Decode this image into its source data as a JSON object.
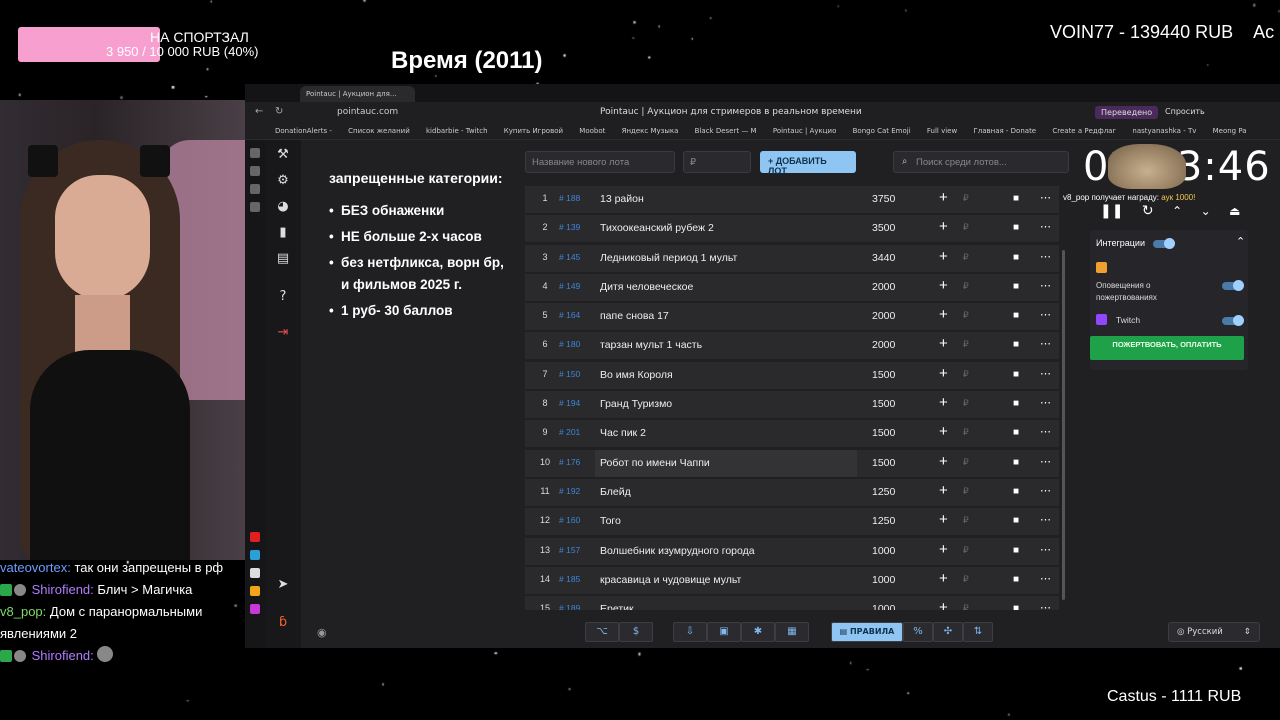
{
  "overlay": {
    "goal_title": "НА СПОРТЗАЛ",
    "goal_amount": "3 950 / 10 000 RUB (40%)",
    "goal_progress": 0.395,
    "movie_title": "Время (2011)",
    "top_donor": "VOIN77 - 139440 RUB",
    "top_donor_extra": "Ac",
    "bottom_donor": "Castus - 1111 RUB"
  },
  "chat": [
    {
      "user": "vateovortex:",
      "text": "так они запрещены в рф"
    },
    {
      "user": "Shirofiend:",
      "text": "Блич > Магичка"
    },
    {
      "user": "v8_pop:",
      "text": "Дом с паранормальными"
    },
    {
      "user": "",
      "text": "явлениями 2"
    },
    {
      "user": "Shirofiend:",
      "text": ""
    }
  ],
  "browser": {
    "tab_title": "Pointauc | Аукцион для...",
    "url": "pointauc.com",
    "page_title": "Pointauc | Аукцион для стримеров в реальном времени",
    "translated": "Переведено",
    "ask": "Спросить",
    "bookmarks": [
      "DonationAlerts -",
      "Список желаний",
      "kidbarbie - Twitch",
      "Купить Игровой",
      "Moobot",
      "Яндекс Музыка",
      "Black Desert — М",
      "Pointauc | Аукцио",
      "Bongo Cat Emoji",
      "Full view",
      "Главная - Donate",
      "Create a Редфлаг",
      "nastyanashka - Tv",
      "Meong Pa"
    ]
  },
  "rules": {
    "title": "запрещенные категории:",
    "items": [
      "БЕЗ обнаженки",
      "НЕ больше 2-х часов",
      "без нетфликса, ворн бр, и фильмов 2025 г.",
      "1 руб- 30 баллов"
    ]
  },
  "toolbar": {
    "lot_placeholder": "Название нового лота",
    "amount_placeholder": "₽",
    "add_label": "+ ДОБАВИТЬ ЛОТ",
    "search_placeholder": "Поиск среди лотов..."
  },
  "lots": [
    {
      "n": "1",
      "id": "# 188",
      "name": "13 район",
      "amount": "3750"
    },
    {
      "n": "2",
      "id": "# 139",
      "name": "Тихоокеанский рубеж 2",
      "amount": "3500"
    },
    {
      "n": "3",
      "id": "# 145",
      "name": "Ледниковый период 1 мульт",
      "amount": "3440"
    },
    {
      "n": "4",
      "id": "# 149",
      "name": "Дитя человеческое",
      "amount": "2000"
    },
    {
      "n": "5",
      "id": "# 164",
      "name": "папе снова 17",
      "amount": "2000"
    },
    {
      "n": "6",
      "id": "# 180",
      "name": "тарзан мульт 1 часть",
      "amount": "2000"
    },
    {
      "n": "7",
      "id": "# 150",
      "name": "Во имя Короля",
      "amount": "1500"
    },
    {
      "n": "8",
      "id": "# 194",
      "name": "Гранд Туризмо",
      "amount": "1500"
    },
    {
      "n": "9",
      "id": "# 201",
      "name": "Час пик 2",
      "amount": "1500"
    },
    {
      "n": "10",
      "id": "# 176",
      "name": "Робот по имени Чаппи",
      "amount": "1500"
    },
    {
      "n": "11",
      "id": "# 192",
      "name": "Блейд",
      "amount": "1250"
    },
    {
      "n": "12",
      "id": "# 160",
      "name": "Того",
      "amount": "1250"
    },
    {
      "n": "13",
      "id": "# 157",
      "name": "Волшебник изумрудного города",
      "amount": "1000"
    },
    {
      "n": "14",
      "id": "# 185",
      "name": "красавица и чудовище мульт",
      "amount": "1000"
    },
    {
      "n": "15",
      "id": "# 189",
      "name": "Еретик",
      "amount": "1000"
    }
  ],
  "timer": {
    "value": "02:23:46",
    "reward_user": "v8_pop",
    "reward_text": " получает награду: ",
    "reward_value": "аук 1000!"
  },
  "integrations": {
    "title": "Интеграции",
    "donation_alerts": "Оповещения о пожертвованиях",
    "twitch": "Twitch",
    "donate_button": "ПОЖЕРТВОВАТЬ, ОПЛАТИТЬ"
  },
  "bottom": {
    "rules_label": "ПРАВИЛА",
    "percent": "%",
    "language": "Русский"
  }
}
